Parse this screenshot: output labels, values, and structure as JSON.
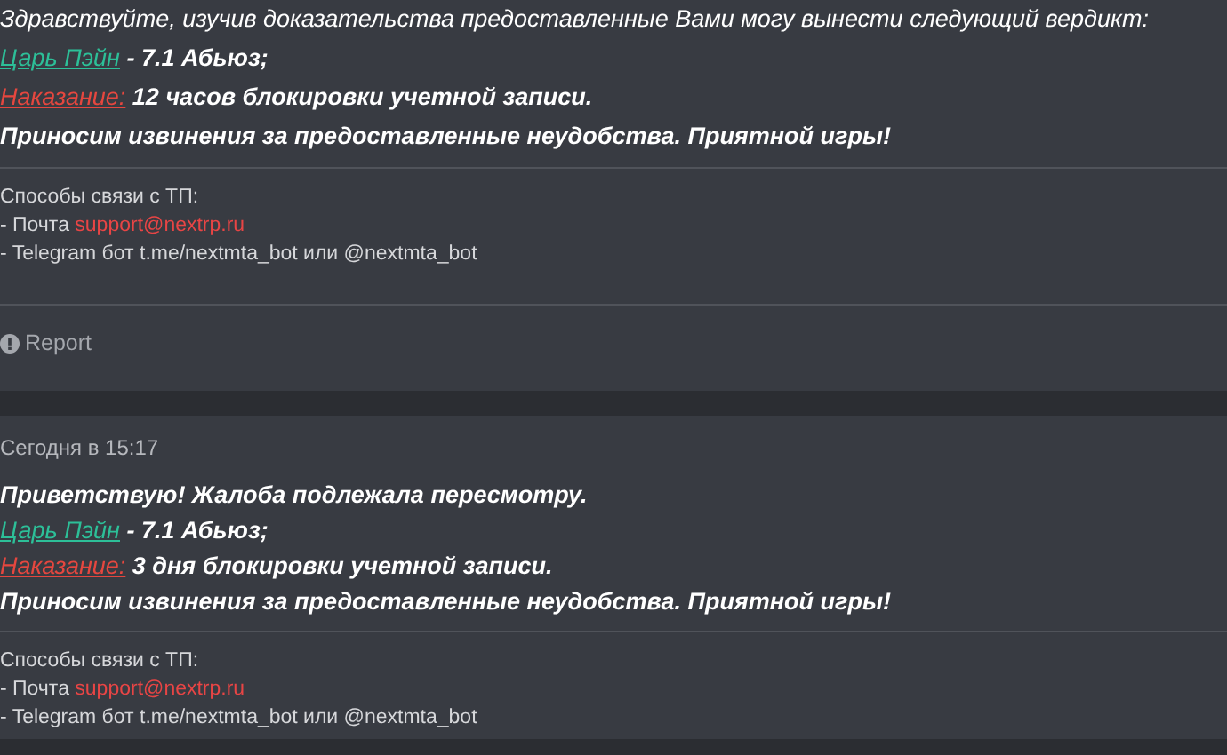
{
  "posts": [
    {
      "message": [
        {
          "kind": "plain",
          "bold": false,
          "text": "Здравствуйте, изучив доказательства предоставленные Вами могу вынести следующий вердикт:"
        },
        {
          "kind": "violator",
          "link": "Царь Пэйн",
          "text": " - 7.1 Абьюз;"
        },
        {
          "kind": "punishment",
          "link": "Наказание:",
          "text": " 12 часов блокировки учетной записи."
        },
        {
          "kind": "plain",
          "bold": true,
          "text": "Приносим извинения за предоставленные неудобства. Приятной игры!"
        }
      ],
      "signature": {
        "title": "Способы связи с ТП:",
        "mail_prefix": "- Почта ",
        "mail": "support@nextrp.ru",
        "telegram": "- Telegram бот t.me/nextmta_bot или @nextmta_bot"
      },
      "report": "Report"
    },
    {
      "date": "Сегодня в 15:17",
      "message": [
        {
          "kind": "plain",
          "bold": true,
          "text": "Приветствую! Жалоба подлежала пересмотру."
        },
        {
          "kind": "violator",
          "link": "Царь Пэйн",
          "text": " - 7.1 Абьюз;"
        },
        {
          "kind": "punishment",
          "link": "Наказание:",
          "text": " 3 дня блокировки учетной записи."
        },
        {
          "kind": "plain",
          "bold": true,
          "text": "Приносим извинения за предоставленные неудобства. Приятной игры!"
        }
      ],
      "signature": {
        "title": "Способы связи с ТП:",
        "mail_prefix": "- Почта ",
        "mail": "support@nextrp.ru",
        "telegram": "- Telegram бот t.me/nextmta_bot или @nextmta_bot"
      }
    }
  ]
}
